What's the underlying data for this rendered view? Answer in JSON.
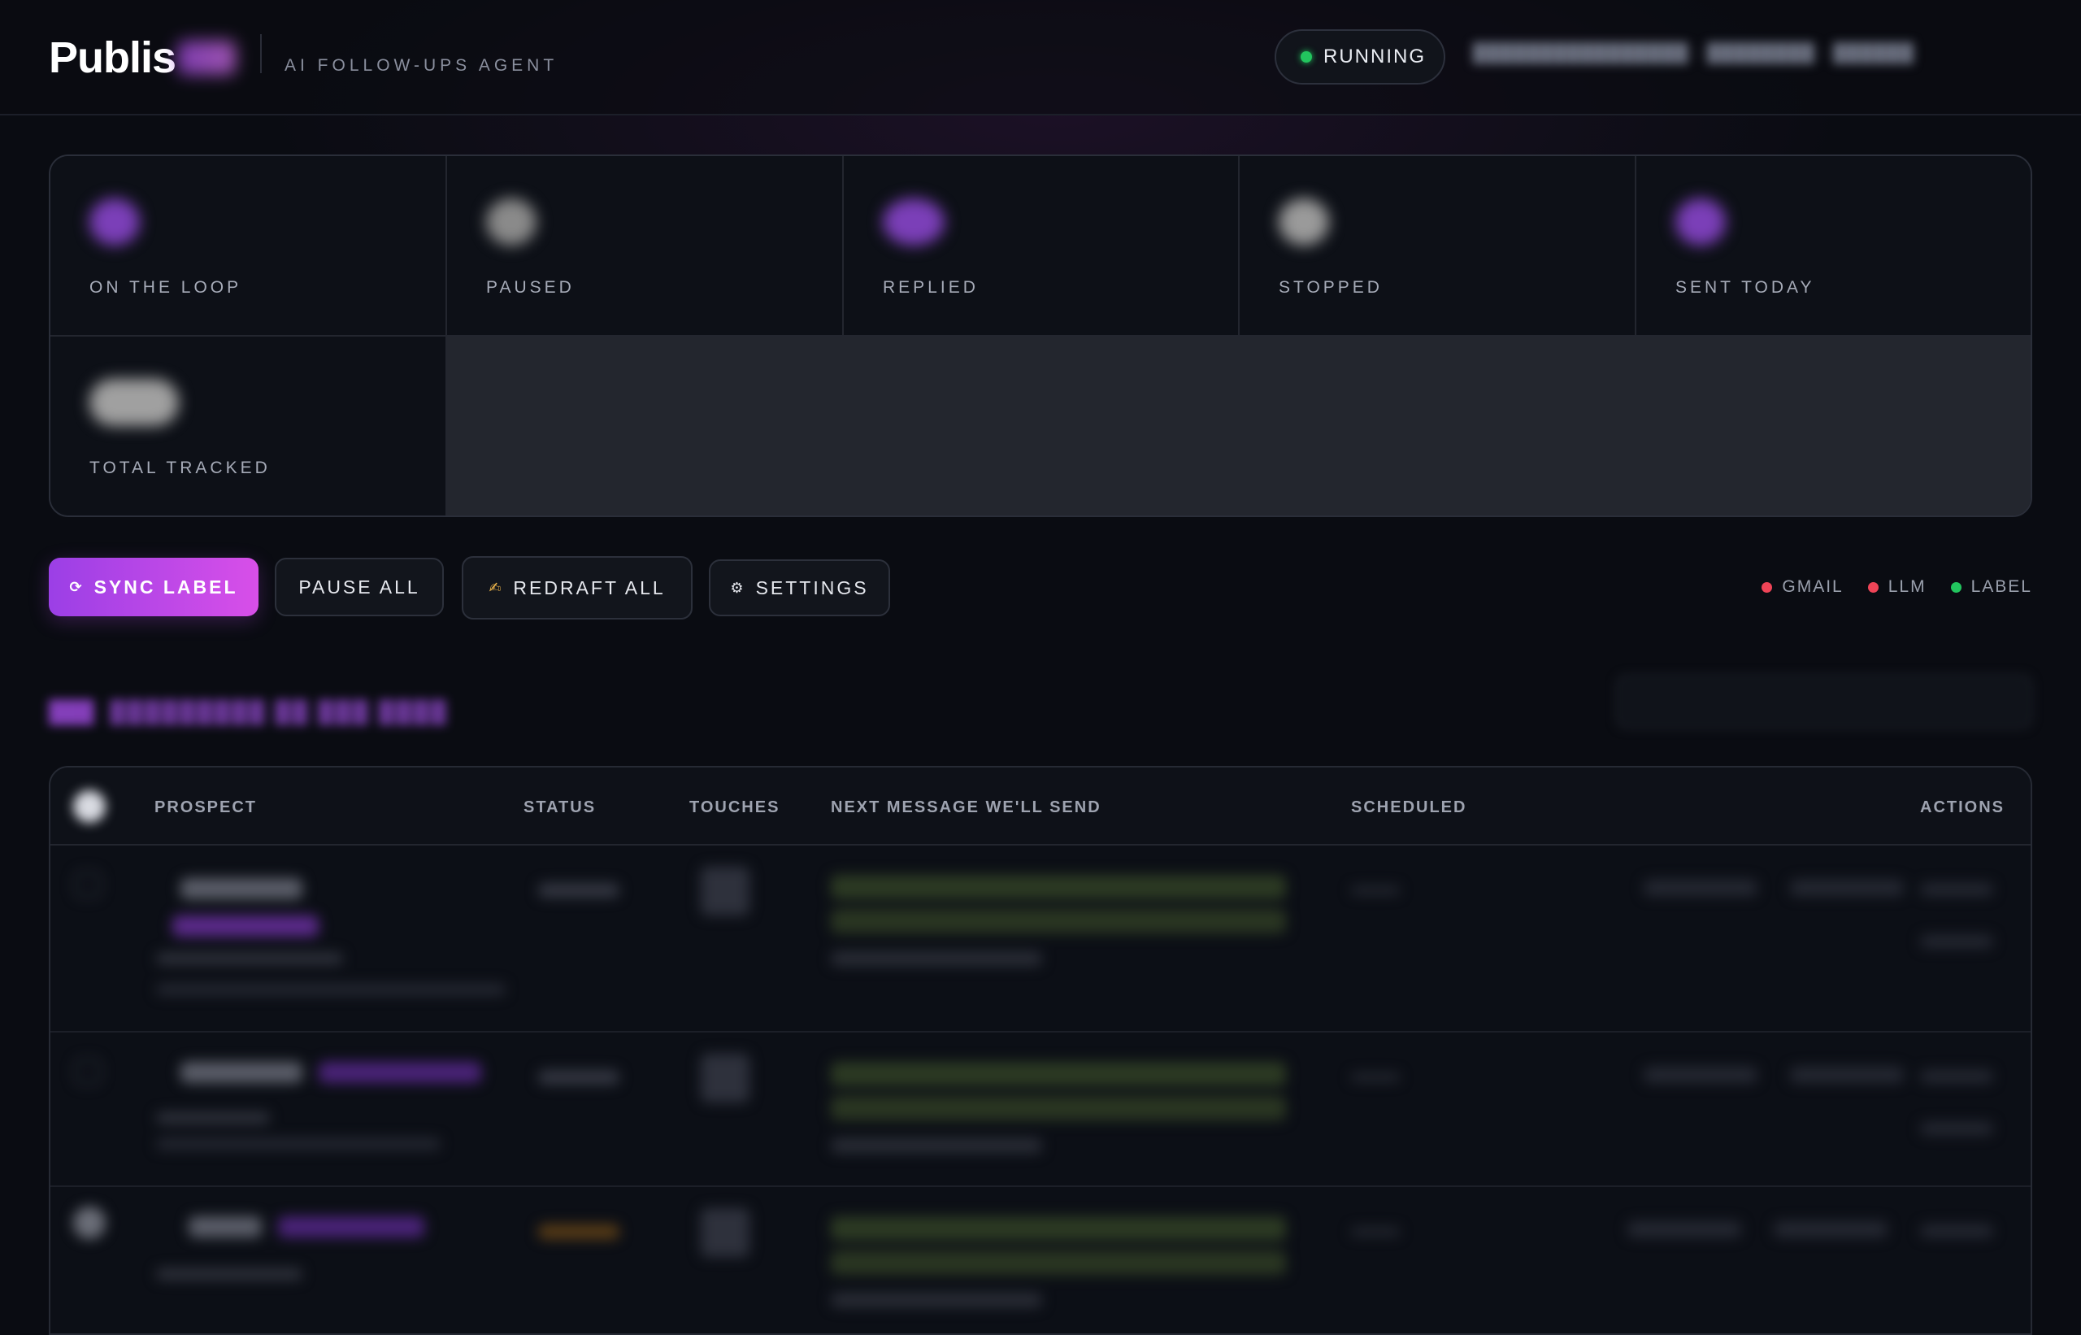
{
  "header": {
    "brand": "Publis",
    "tagline": "AI FOLLOW-UPS AGENT",
    "status": "RUNNING"
  },
  "stats": [
    {
      "label": "ON THE LOOP",
      "color": "#7b3fb8"
    },
    {
      "label": "PAUSED",
      "color": "#8a8a8a"
    },
    {
      "label": "REPLIED",
      "color": "#7b3fb8"
    },
    {
      "label": "STOPPED",
      "color": "#9a9a9a"
    },
    {
      "label": "SENT TODAY",
      "color": "#7b3fb8"
    },
    {
      "label": "TOTAL TRACKED",
      "color": "#a0a0a0"
    }
  ],
  "toolbar": {
    "sync_label": "SYNC LABEL",
    "sync_icon": "⟳",
    "pause_all": "PAUSE ALL",
    "redraft_all": "REDRAFT ALL",
    "redraft_icon": "✍",
    "settings": "SETTINGS",
    "settings_icon": "⚙"
  },
  "legend": [
    {
      "label": "GMAIL",
      "color": "#ef4457"
    },
    {
      "label": "LLM",
      "color": "#ef4457"
    },
    {
      "label": "LABEL",
      "color": "#22c55e"
    }
  ],
  "table": {
    "columns": {
      "prospect": "PROSPECT",
      "status": "STATUS",
      "touches": "TOUCHES",
      "next_message": "NEXT MESSAGE WE'LL SEND",
      "scheduled": "SCHEDULED",
      "actions": "ACTIONS"
    }
  },
  "colors": {
    "accent_start": "#9b3fe6",
    "accent_end": "#d84fe8",
    "running": "#22c55e",
    "error": "#ef4457"
  }
}
